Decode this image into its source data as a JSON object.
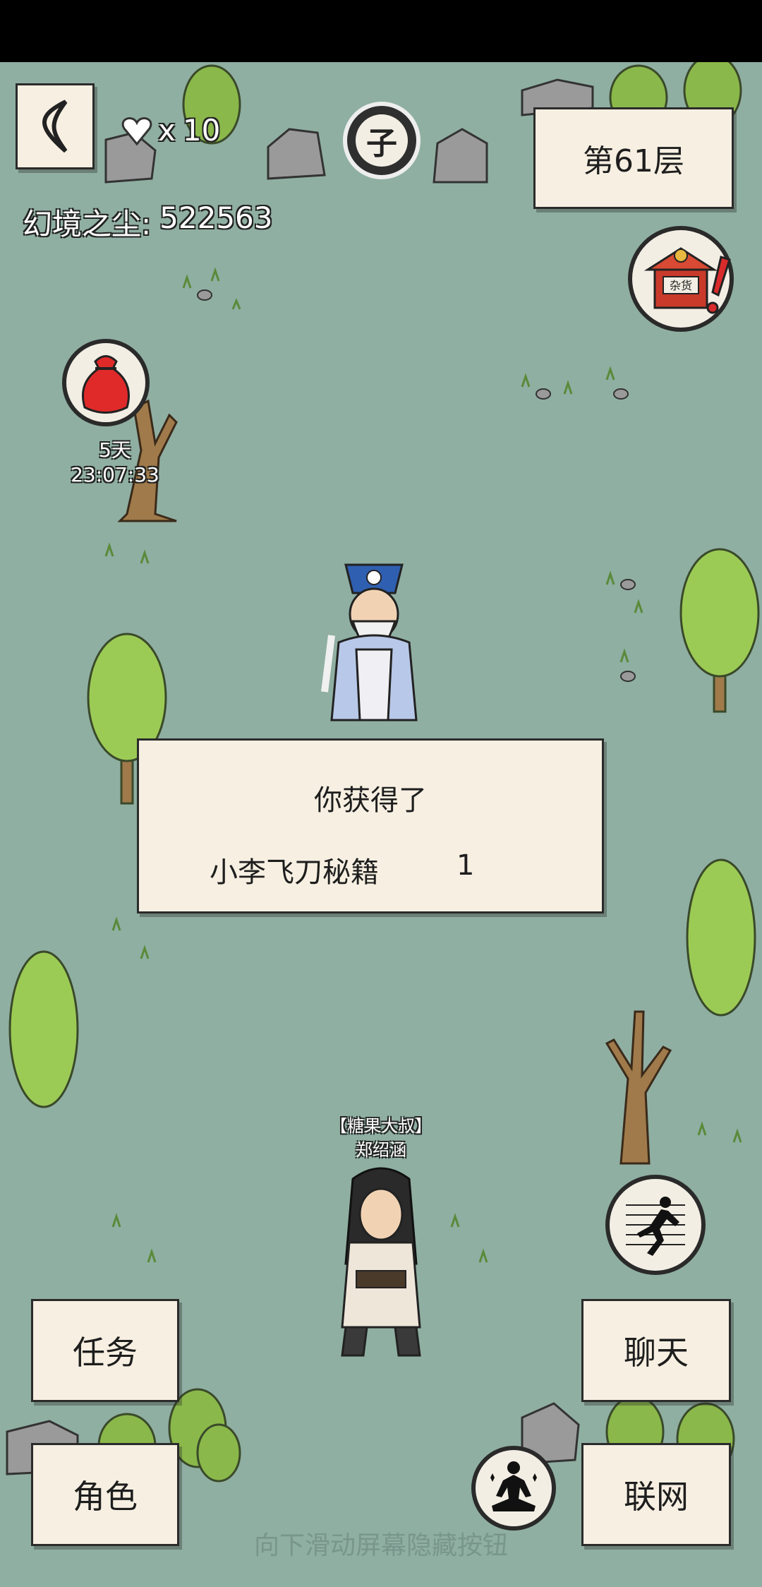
{
  "hud": {
    "back_icon": "back-arrow-icon",
    "lives_prefix": "x",
    "lives_count": "10",
    "dust_label": "幻境之尘:",
    "dust_value": "522563",
    "zodiac_char": "子",
    "floor_label": "第61层"
  },
  "shop": {
    "sign_text": "杂货",
    "icon": "general-store-icon"
  },
  "lucky_bag": {
    "timer": "5天23:07:33",
    "icon": "red-pouch-icon"
  },
  "npc_player": {
    "title": "【糖果大叔】",
    "name": "郑绍涵"
  },
  "reward_dialog": {
    "heading": "你获得了",
    "item_name": "小李飞刀秘籍",
    "item_count": "1"
  },
  "buttons": {
    "task": "任务",
    "chat": "聊天",
    "role": "角色",
    "network": "联网"
  },
  "footer_hint": "向下滑动屏幕隐藏按钮",
  "colors": {
    "ground": "#8fafa2",
    "paper": "#f7f0e2",
    "ink": "#2b2b2b"
  }
}
